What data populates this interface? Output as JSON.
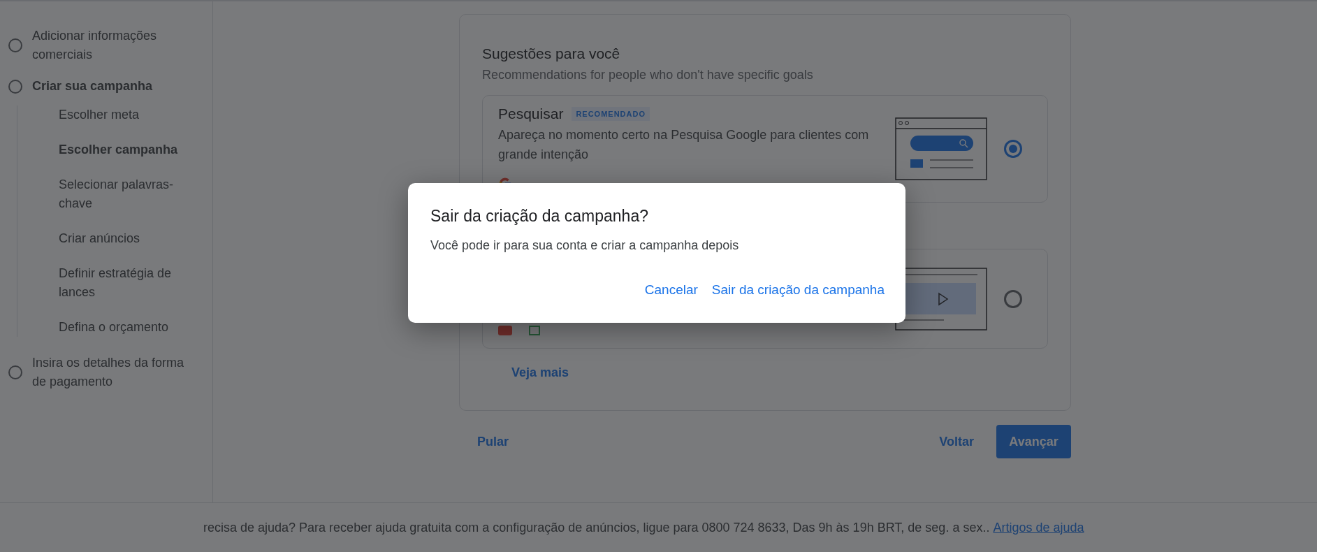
{
  "sidebar": {
    "steps": [
      {
        "label": "Adicionar informações comerciais",
        "selected": false
      },
      {
        "label": "Criar sua campanha",
        "selected": true,
        "children": [
          {
            "label": "Escolher meta",
            "selected": false
          },
          {
            "label": "Escolher campanha",
            "selected": true
          },
          {
            "label": "Selecionar palavras-chave",
            "selected": false
          },
          {
            "label": "Criar anúncios",
            "selected": false
          },
          {
            "label": "Definir estratégia de lances",
            "selected": false
          },
          {
            "label": "Defina o orçamento",
            "selected": false
          }
        ]
      },
      {
        "label": "Insira os detalhes da forma de pagamento",
        "selected": false
      }
    ]
  },
  "suggestions": {
    "title": "Sugestões para você",
    "subtitle": "Recommendations for people who don't have specific goals",
    "options": [
      {
        "kind": "search",
        "title": "Pesquisar",
        "badge": "RECOMENDADO",
        "description": "Apareça no momento certo na Pesquisa Google para clientes com grande intenção",
        "selected": true
      },
      {
        "kind": "video",
        "selected": false
      }
    ],
    "more_link": "Veja mais"
  },
  "actions": {
    "skip": "Pular",
    "back": "Voltar",
    "next": "Avançar"
  },
  "footer": {
    "text": "recisa de ajuda? Para receber ajuda gratuita com a configuração de anúncios, ligue para 0800 724 8633, Das 9h às 19h BRT, de seg. a sex..",
    "link": "Artigos de ajuda"
  },
  "dialog": {
    "title": "Sair da criação da campanha?",
    "body": "Você pode ir para sua conta e criar a campanha depois",
    "buttons": [
      "Cancelar",
      "Sair da criação da campanha"
    ]
  }
}
